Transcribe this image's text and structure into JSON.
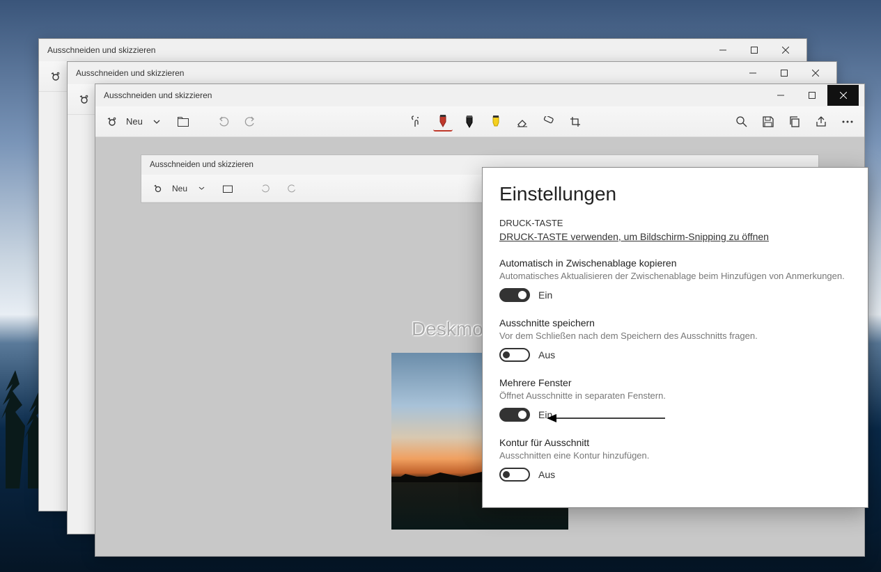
{
  "windows": {
    "back1": {
      "title": "Ausschneiden und skizzieren"
    },
    "back2": {
      "title": "Ausschneiden und skizzieren"
    },
    "front": {
      "title": "Ausschneiden und skizzieren"
    }
  },
  "toolbar": {
    "neu": "Neu"
  },
  "inner_screenshot": {
    "title": "Ausschneiden und skizzieren",
    "neu": "Neu"
  },
  "watermark": "Deskmodder.de",
  "settings": {
    "heading": "Einstellungen",
    "print_key_caps": "DRUCK-TASTE",
    "print_key_link": "DRUCK-TASTE verwenden, um Bildschirm-Snipping zu öffnen",
    "clipboard": {
      "title": "Automatisch in Zwischenablage kopieren",
      "desc": "Automatisches Aktualisieren der Zwischenablage beim Hinzufügen von Anmerkungen.",
      "state": "Ein"
    },
    "save_snips": {
      "title": "Ausschnitte speichern",
      "desc": "Vor dem Schließen nach dem Speichern des Ausschnitts fragen.",
      "state": "Aus"
    },
    "multi_window": {
      "title": "Mehrere Fenster",
      "desc": "Öffnet Ausschnitte in separaten Fenstern.",
      "state": "Ein"
    },
    "outline": {
      "title": "Kontur für Ausschnitt",
      "desc": "Ausschnitten eine Kontur hinzufügen.",
      "state": "Aus"
    }
  }
}
